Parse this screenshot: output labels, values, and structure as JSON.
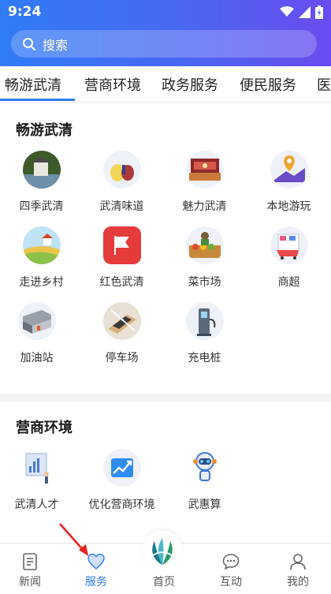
{
  "status": {
    "time": "9:24"
  },
  "search": {
    "placeholder": "搜索"
  },
  "tabs": [
    "畅游武清",
    "营商环境",
    "政务服务",
    "便民服务",
    "医"
  ],
  "sections": [
    {
      "title": "畅游武清",
      "items": [
        {
          "label": "四季武清",
          "icon": "scenery-icon"
        },
        {
          "label": "武清味道",
          "icon": "food-icon"
        },
        {
          "label": "魅力武清",
          "icon": "stage-icon"
        },
        {
          "label": "本地游玩",
          "icon": "map-pin-icon"
        },
        {
          "label": "走进乡村",
          "icon": "village-icon"
        },
        {
          "label": "红色武清",
          "icon": "red-flag-icon"
        },
        {
          "label": "菜市场",
          "icon": "vegetable-market-icon"
        },
        {
          "label": "商超",
          "icon": "supermarket-icon"
        },
        {
          "label": "加油站",
          "icon": "gas-station-icon"
        },
        {
          "label": "停车场",
          "icon": "parking-icon"
        },
        {
          "label": "充电桩",
          "icon": "charging-pile-icon"
        }
      ]
    },
    {
      "title": "营商环境",
      "items": [
        {
          "label": "武清人才",
          "icon": "talent-icon"
        },
        {
          "label": "优化营商环境",
          "icon": "growth-chart-icon"
        },
        {
          "label": "武惠算",
          "icon": "robot-icon"
        }
      ]
    }
  ],
  "bottom_nav": [
    {
      "label": "新闻",
      "icon": "news-icon"
    },
    {
      "label": "服务",
      "icon": "heart-icon",
      "active": true
    },
    {
      "label": "首页",
      "icon": "home-logo-icon"
    },
    {
      "label": "互动",
      "icon": "chat-icon"
    },
    {
      "label": "我的",
      "icon": "user-icon"
    }
  ],
  "colors": {
    "accent": "#2f7cf6",
    "header_end": "#6a4cf0"
  }
}
